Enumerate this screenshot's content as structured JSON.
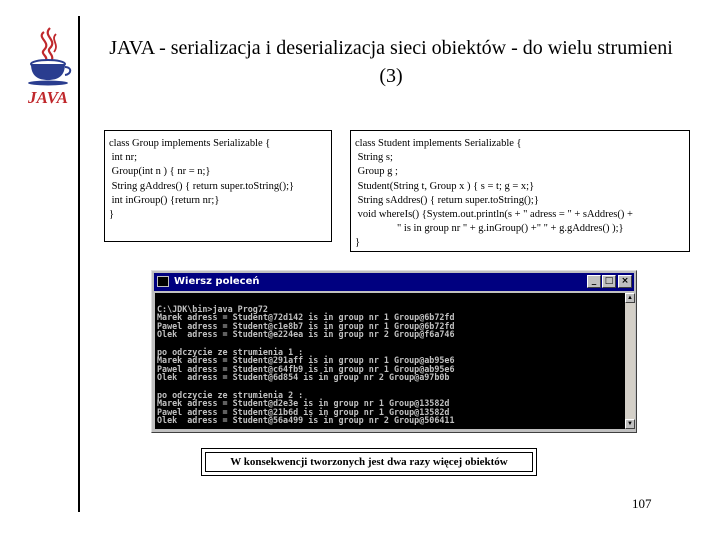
{
  "slide": {
    "title": "JAVA - serializacja i deserializacja sieci obiektów - do wielu strumieni (3)",
    "page_number": "107",
    "logo_text": "JAVA"
  },
  "code_left": {
    "lines": [
      "class Group implements Serializable {",
      " int nr;",
      " Group(int n ) { nr = n;}",
      " String gAddres() { return super.toString();}",
      " int inGroup() {return nr;}",
      "}"
    ]
  },
  "code_right": {
    "lines": [
      "class Student implements Serializable {",
      " String s;",
      " Group g ;",
      " Student(String t, Group x ) { s = t; g = x;}",
      " String sAddres() { return super.toString();}",
      " void whereIs() {System.out.println(s + \" adress = \" + sAddres() +",
      "                \" is in group nr \" + g.inGroup() +\" \" + g.gAddres() );}",
      "}"
    ]
  },
  "cmd_window": {
    "title": "Wiersz poleceń",
    "lines": [
      "",
      "C:\\JDK\\bin>java Prog72",
      "Marek adress = Student@72d142 is in group nr 1 Group@6b72fd",
      "Pawel adress = Student@c1e8b7 is in group nr 1 Group@6b72fd",
      "Olek  adress = Student@e224ea is in group nr 2 Group@f6a746",
      "",
      "po odczycie ze strumienia 1 :",
      "Marek adress = Student@291aff is in group nr 1 Group@ab95e6",
      "Pawel adress = Student@c64fb9 is in group nr 1 Group@ab95e6",
      "Olek  adress = Student@6d854 is in group nr 2 Group@a97b0b",
      "",
      "po odczycie ze strumienia 2 :",
      "Marek adress = Student@d2e3e is in group nr 1 Group@13582d",
      "Pawel adress = Student@21b6d is in group nr 1 Group@13582d",
      "Olek  adress = Student@56a499 is in group nr 2 Group@506411"
    ]
  },
  "caption": {
    "text": "W konsekwencji tworzonych jest dwa razy więcej obiektów"
  },
  "colors": {
    "titlebar": "#000080",
    "console_bg": "#000000",
    "console_fg": "#c0c0c0",
    "logo_red": "#c0282c",
    "logo_blue": "#2a3d8f"
  }
}
